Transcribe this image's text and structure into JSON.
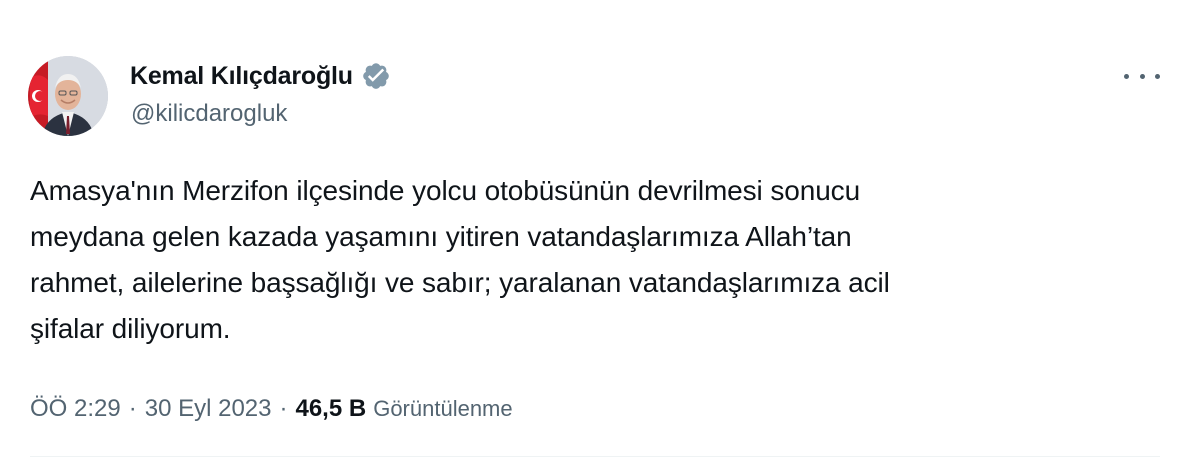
{
  "author": {
    "display_name": "Kemal Kılıçdaroğlu",
    "handle": "@kilicdarogluk"
  },
  "tweet": {
    "text": "Amasya'nın Merzifon ilçesinde yolcu otobüsünün devrilmesi sonucu\nmeydana gelen kazada yaşamını yitiren vatandaşlarımıza Allah’tan\nrahmet, ailelerine başsağlığı ve sabır; yaralanan vatandaşlarımıza acil\nşifalar diliyorum.",
    "time": "ÖÖ 2:29",
    "date": "30 Eyl 2023",
    "separator": "·",
    "views_count": "46,5 B",
    "views_label": "Görüntülenme"
  },
  "icons": {
    "verified": "verified-badge-icon",
    "more": "more-horizontal-icon"
  },
  "colors": {
    "primary_text": "#0f1419",
    "secondary_text": "#536471",
    "verified_badge": "#829aab",
    "divider": "#eff3f4"
  }
}
